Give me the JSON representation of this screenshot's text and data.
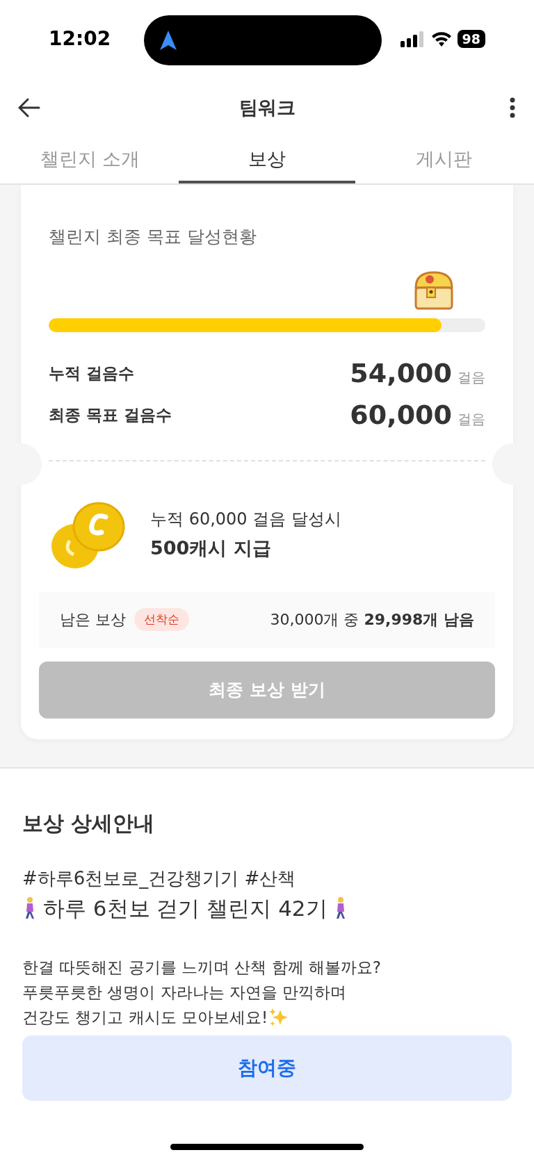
{
  "status_bar": {
    "time": "12:02",
    "battery": "98"
  },
  "header": {
    "title": "팀워크"
  },
  "tabs": [
    {
      "label": "챌린지 소개",
      "selected": false
    },
    {
      "label": "보상",
      "selected": true
    },
    {
      "label": "게시판",
      "selected": false
    }
  ],
  "progress_card": {
    "title": "챌린지 최종 목표 달성현황",
    "level": 0.9,
    "stats": [
      {
        "label": "누적 걸음수",
        "value": "54,000",
        "unit": "걸음"
      },
      {
        "label": "최종 목표 걸음수",
        "value": "60,000",
        "unit": "걸음"
      }
    ],
    "reward": {
      "condition": "누적 60,000 걸음 달성시",
      "amount": "500캐시 지급"
    },
    "remaining": {
      "label": "남은 보상",
      "badge": "선착순",
      "count": "30,000개 중 **29,998개 남음**"
    },
    "claim_button": {
      "label": "최종 보상 받기",
      "disabled": true
    }
  },
  "details": {
    "title": "보상 상세안내",
    "hashtags": "#하루6천보로_건강챙기기 #산책",
    "headline": "하루 6천보 걷기 챌린지 42기",
    "paragraph": [
      "한결 따뜻해진 공기를 느끼며 산책 함께 해볼까요?",
      "푸릇푸릇한 생명이 자라나는 자연을 만끽하며",
      "건강도 챙기고 캐시도 모아보세요!"
    ]
  },
  "join_button": {
    "label": "참여중"
  }
}
